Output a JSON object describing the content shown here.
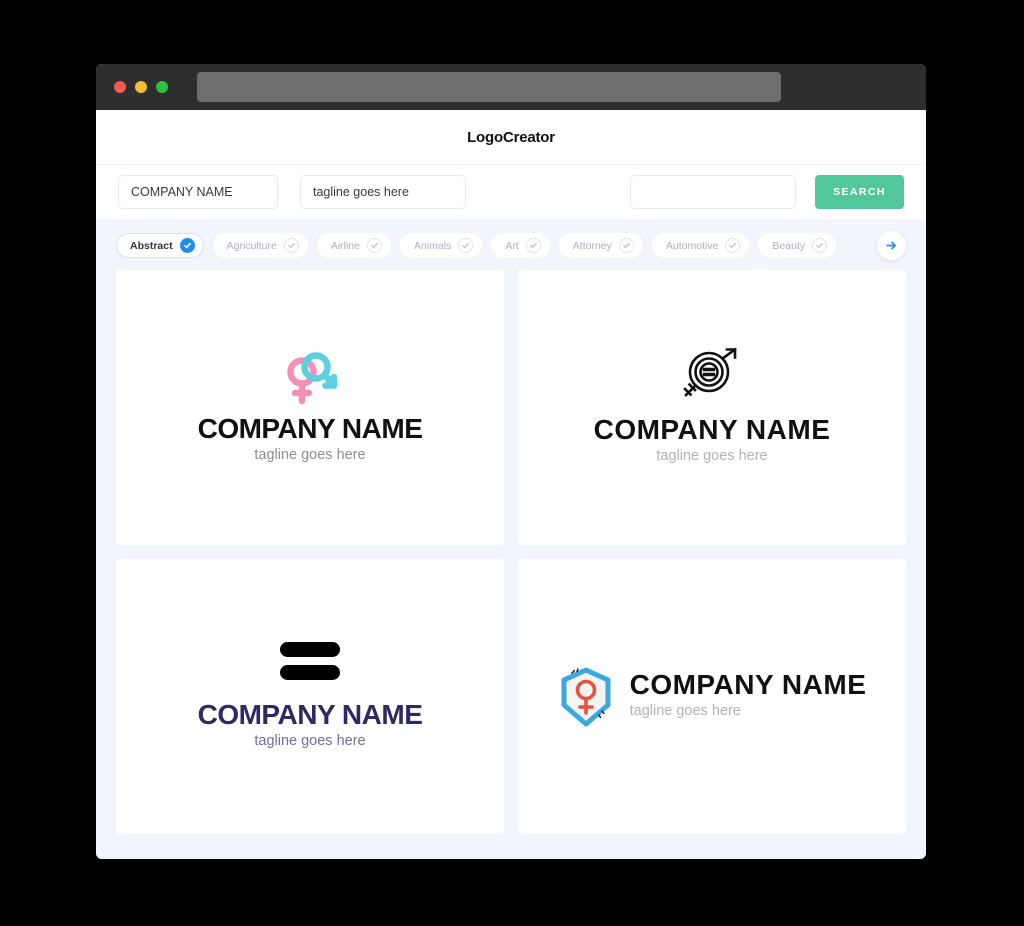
{
  "browser": {
    "traffic_lights": [
      "close",
      "minimize",
      "maximize"
    ],
    "url_value": ""
  },
  "header": {
    "title": "LogoCreator"
  },
  "searchbar": {
    "company_value": "COMPANY NAME",
    "company_placeholder": "COMPANY NAME",
    "tagline_value": "tagline goes here",
    "tagline_placeholder": "tagline goes here",
    "keyword_value": "",
    "keyword_placeholder": "",
    "search_label": "SEARCH",
    "search_color": "#52c79c"
  },
  "categories": {
    "active": "Abstract",
    "accent_color": "#1e8cf0",
    "next_icon": "arrow-right-icon",
    "items": [
      {
        "label": "Abstract",
        "active": true
      },
      {
        "label": "Agriculture",
        "active": false
      },
      {
        "label": "Airline",
        "active": false
      },
      {
        "label": "Animals",
        "active": false
      },
      {
        "label": "Art",
        "active": false
      },
      {
        "label": "Attorney",
        "active": false
      },
      {
        "label": "Automotive",
        "active": false
      },
      {
        "label": "Beauty",
        "active": false
      }
    ]
  },
  "results": {
    "cards": [
      {
        "icon": "gender-symbols-pink-blue-icon",
        "name": "COMPANY NAME",
        "tagline": "tagline goes here",
        "layout": "stacked",
        "name_color": "#111111",
        "tagline_color": "#8e8e8e",
        "mark_colors": [
          "#f48fb6",
          "#5ccfe0"
        ]
      },
      {
        "icon": "target-equals-gender-outline-icon",
        "name": "COMPANY NAME",
        "tagline": "tagline goes here",
        "layout": "stacked",
        "name_color": "#111111",
        "tagline_color": "#b3b3b3",
        "mark_colors": [
          "#111111"
        ]
      },
      {
        "icon": "equals-bars-icon",
        "name": "COMPANY NAME",
        "tagline": "tagline goes here",
        "layout": "stacked",
        "name_color": "#2e2a64",
        "tagline_color": "#6f6f9e",
        "mark_colors": [
          "#000000"
        ]
      },
      {
        "icon": "shield-female-symbol-icon",
        "name": "COMPANY NAME",
        "tagline": "tagline goes here",
        "layout": "horizontal",
        "name_color": "#111111",
        "tagline_color": "#b3b3b3",
        "mark_colors": [
          "#3aa9e0",
          "#e8523f"
        ]
      }
    ]
  }
}
